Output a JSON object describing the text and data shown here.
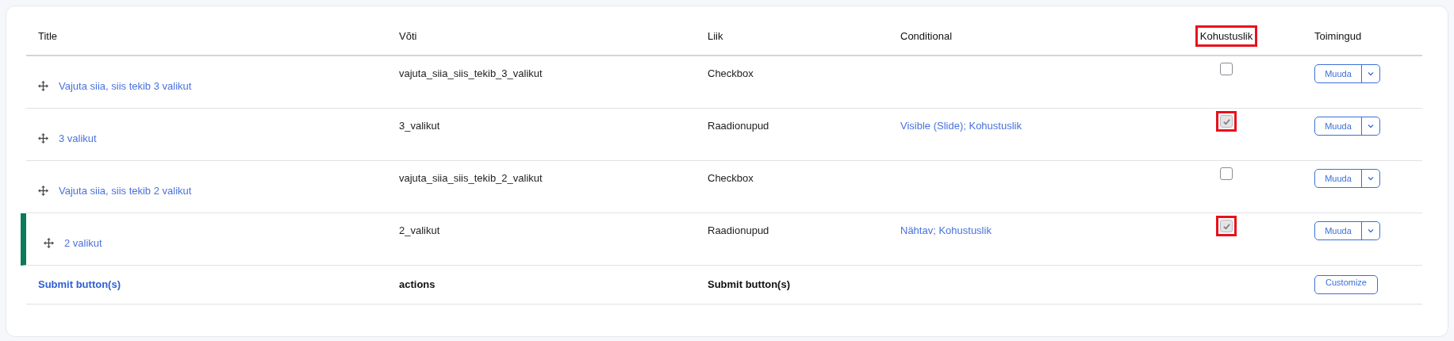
{
  "table": {
    "columns": [
      {
        "label": "Title",
        "highlighted": false
      },
      {
        "label": "Võti",
        "highlighted": false
      },
      {
        "label": "Liik",
        "highlighted": false
      },
      {
        "label": "Conditional",
        "highlighted": false
      },
      {
        "label": "Kohustuslik",
        "highlighted": true
      },
      {
        "label": "Toimingud",
        "highlighted": false
      }
    ],
    "rows": [
      {
        "title": "Vajuta siia, siis tekib 3 valikut",
        "key": "vajuta_siia_siis_tekib_3_valikut",
        "type": "Checkbox",
        "required": false,
        "highlighted": false,
        "marked": false,
        "action": "Muuda"
      },
      {
        "title": "3 valikut",
        "key": "3_valikut",
        "type": "Raadionupud",
        "conditional": "Visible (Slide); Kohustuslik",
        "required": true,
        "highlighted": true,
        "marked": false,
        "action": "Muuda"
      },
      {
        "title": "Vajuta siia, siis tekib 2 valikut",
        "key": "vajuta_siia_siis_tekib_2_valikut",
        "type": "Checkbox",
        "required": false,
        "highlighted": false,
        "marked": false,
        "action": "Muuda"
      },
      {
        "title": "2 valikut",
        "key": "2_valikut",
        "type": "Raadionupud",
        "conditional": "Nähtav; Kohustuslik",
        "required": true,
        "highlighted": true,
        "marked": true,
        "action": "Muuda"
      }
    ],
    "footer": {
      "title": "Submit button(s)",
      "key": "actions",
      "type": "Submit button(s)",
      "action": "Customize"
    }
  }
}
